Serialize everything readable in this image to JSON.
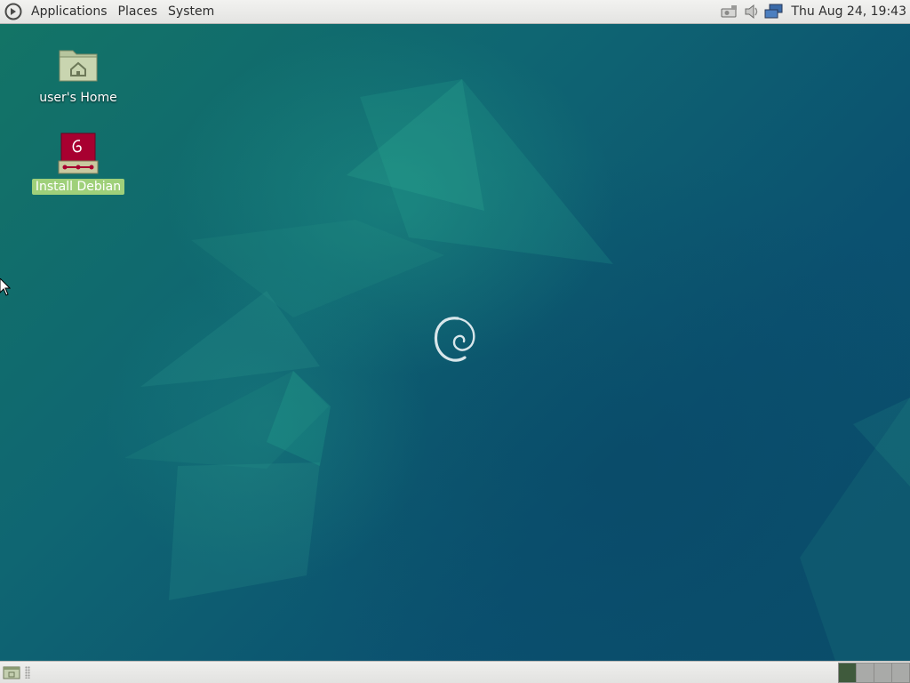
{
  "top_panel": {
    "menus": {
      "applications": "Applications",
      "places": "Places",
      "system": "System"
    },
    "tray_icons": [
      "network-wired-icon",
      "volume-icon",
      "network-icon"
    ],
    "clock": "Thu Aug 24, 19:43"
  },
  "desktop": {
    "icons": [
      {
        "label": "user's Home",
        "icon": "home-folder-icon"
      },
      {
        "label": "Install Debian",
        "icon": "debian-installer-icon",
        "selected": true
      }
    ]
  },
  "bottom_panel": {
    "show_desktop_icon": "show-desktop-icon",
    "workspaces": 4,
    "active_workspace": 1
  },
  "colors": {
    "panel": "#e8e8e6",
    "desktop_teal": "#0f6672",
    "selection": "#9fd07a",
    "debian_red": "#a80030"
  }
}
